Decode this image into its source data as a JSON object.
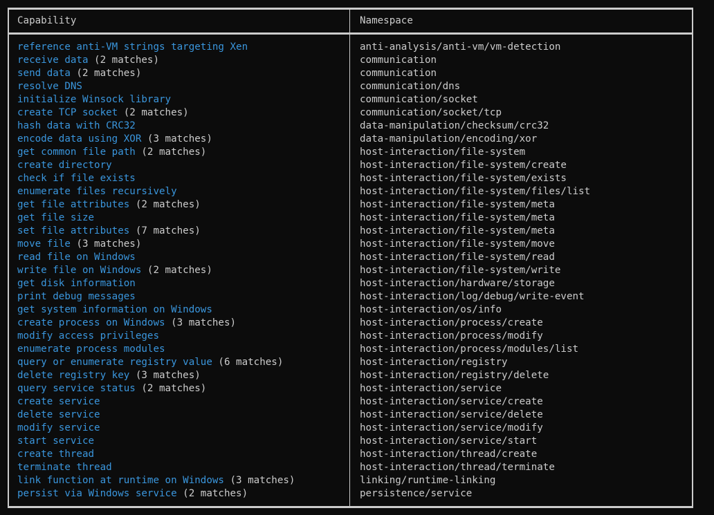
{
  "table": {
    "headers": {
      "capability": "Capability",
      "namespace": "Namespace"
    },
    "rows": [
      {
        "capability": "reference anti-VM strings targeting Xen",
        "matches": "",
        "namespace": "anti-analysis/anti-vm/vm-detection"
      },
      {
        "capability": "receive data",
        "matches": " (2 matches)",
        "namespace": "communication"
      },
      {
        "capability": "send data",
        "matches": " (2 matches)",
        "namespace": "communication"
      },
      {
        "capability": "resolve DNS",
        "matches": "",
        "namespace": "communication/dns"
      },
      {
        "capability": "initialize Winsock library",
        "matches": "",
        "namespace": "communication/socket"
      },
      {
        "capability": "create TCP socket",
        "matches": " (2 matches)",
        "namespace": "communication/socket/tcp"
      },
      {
        "capability": "hash data with CRC32",
        "matches": "",
        "namespace": "data-manipulation/checksum/crc32"
      },
      {
        "capability": "encode data using XOR",
        "matches": " (3 matches)",
        "namespace": "data-manipulation/encoding/xor"
      },
      {
        "capability": "get common file path",
        "matches": " (2 matches)",
        "namespace": "host-interaction/file-system"
      },
      {
        "capability": "create directory",
        "matches": "",
        "namespace": "host-interaction/file-system/create"
      },
      {
        "capability": "check if file exists",
        "matches": "",
        "namespace": "host-interaction/file-system/exists"
      },
      {
        "capability": "enumerate files recursively",
        "matches": "",
        "namespace": "host-interaction/file-system/files/list"
      },
      {
        "capability": "get file attributes",
        "matches": " (2 matches)",
        "namespace": "host-interaction/file-system/meta"
      },
      {
        "capability": "get file size",
        "matches": "",
        "namespace": "host-interaction/file-system/meta"
      },
      {
        "capability": "set file attributes",
        "matches": " (7 matches)",
        "namespace": "host-interaction/file-system/meta"
      },
      {
        "capability": "move file",
        "matches": " (3 matches)",
        "namespace": "host-interaction/file-system/move"
      },
      {
        "capability": "read file on Windows",
        "matches": "",
        "namespace": "host-interaction/file-system/read"
      },
      {
        "capability": "write file on Windows",
        "matches": " (2 matches)",
        "namespace": "host-interaction/file-system/write"
      },
      {
        "capability": "get disk information",
        "matches": "",
        "namespace": "host-interaction/hardware/storage"
      },
      {
        "capability": "print debug messages",
        "matches": "",
        "namespace": "host-interaction/log/debug/write-event"
      },
      {
        "capability": "get system information on Windows",
        "matches": "",
        "namespace": "host-interaction/os/info"
      },
      {
        "capability": "create process on Windows",
        "matches": " (3 matches)",
        "namespace": "host-interaction/process/create"
      },
      {
        "capability": "modify access privileges",
        "matches": "",
        "namespace": "host-interaction/process/modify"
      },
      {
        "capability": "enumerate process modules",
        "matches": "",
        "namespace": "host-interaction/process/modules/list"
      },
      {
        "capability": "query or enumerate registry value",
        "matches": " (6 matches)",
        "namespace": "host-interaction/registry"
      },
      {
        "capability": "delete registry key",
        "matches": " (3 matches)",
        "namespace": "host-interaction/registry/delete"
      },
      {
        "capability": "query service status",
        "matches": " (2 matches)",
        "namespace": "host-interaction/service"
      },
      {
        "capability": "create service",
        "matches": "",
        "namespace": "host-interaction/service/create"
      },
      {
        "capability": "delete service",
        "matches": "",
        "namespace": "host-interaction/service/delete"
      },
      {
        "capability": "modify service",
        "matches": "",
        "namespace": "host-interaction/service/modify"
      },
      {
        "capability": "start service",
        "matches": "",
        "namespace": "host-interaction/service/start"
      },
      {
        "capability": "create thread",
        "matches": "",
        "namespace": "host-interaction/thread/create"
      },
      {
        "capability": "terminate thread",
        "matches": "",
        "namespace": "host-interaction/thread/terminate"
      },
      {
        "capability": "link function at runtime on Windows",
        "matches": " (3 matches)",
        "namespace": "linking/runtime-linking"
      },
      {
        "capability": "persist via Windows service",
        "matches": " (2 matches)",
        "namespace": "persistence/service"
      }
    ]
  },
  "colors": {
    "background": "#0c0c0c",
    "text": "#cccccc",
    "capability": "#3a96dd",
    "border": "#cccccc"
  }
}
